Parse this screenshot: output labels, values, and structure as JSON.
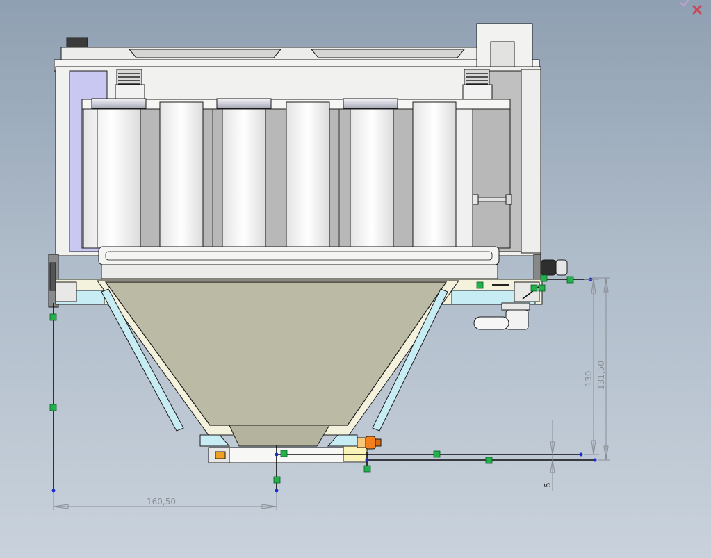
{
  "dimensions": {
    "horizontal_1": "160,50",
    "vertical_1": "130",
    "vertical_2": "131,50",
    "vertical_3": "5"
  },
  "icons": {
    "confirm": "confirm-check-icon",
    "cancel": "cancel-close-icon"
  },
  "colors": {
    "hopper_fill": "#bbbaa5",
    "frame_fill": "#f2f2f0",
    "sketch_line": "#0b0b0b",
    "relation_marker": "#22b14c",
    "sketch_point": "#1b2bd0",
    "dimension": "#8a8f96",
    "nozzle": "#f2801e"
  }
}
